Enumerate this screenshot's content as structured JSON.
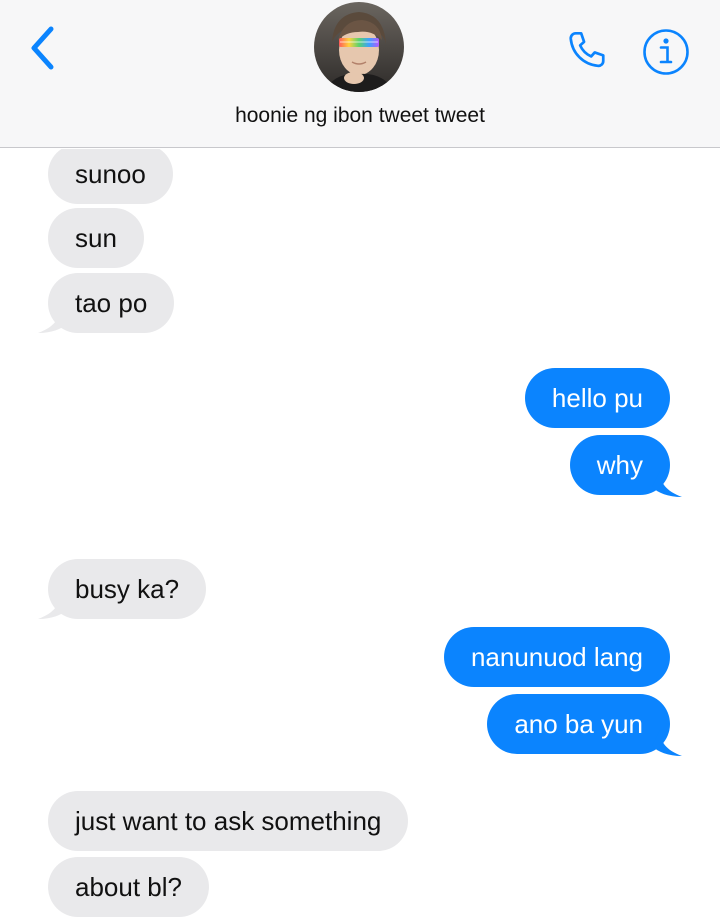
{
  "header": {
    "contact_name": "hoonie ng ibon tweet tweet",
    "back_icon": "chevron-left-icon",
    "call_icon": "phone-icon",
    "info_icon": "info-icon",
    "accent_color": "#0b84fe"
  },
  "messages": [
    {
      "direction": "incoming",
      "text": "sunoo"
    },
    {
      "direction": "incoming",
      "text": "sun"
    },
    {
      "direction": "incoming",
      "text": "tao po"
    },
    {
      "direction": "outgoing",
      "text": "hello pu"
    },
    {
      "direction": "outgoing",
      "text": "why"
    },
    {
      "direction": "incoming",
      "text": "busy ka?"
    },
    {
      "direction": "outgoing",
      "text": "nanunuod lang"
    },
    {
      "direction": "outgoing",
      "text": "ano ba yun"
    },
    {
      "direction": "incoming",
      "text": "just want to ask something"
    },
    {
      "direction": "incoming",
      "text": "about bl?"
    }
  ],
  "colors": {
    "incoming_bubble": "#e9e9eb",
    "outgoing_bubble": "#0b84fe",
    "header_bg": "#f7f7f8"
  }
}
